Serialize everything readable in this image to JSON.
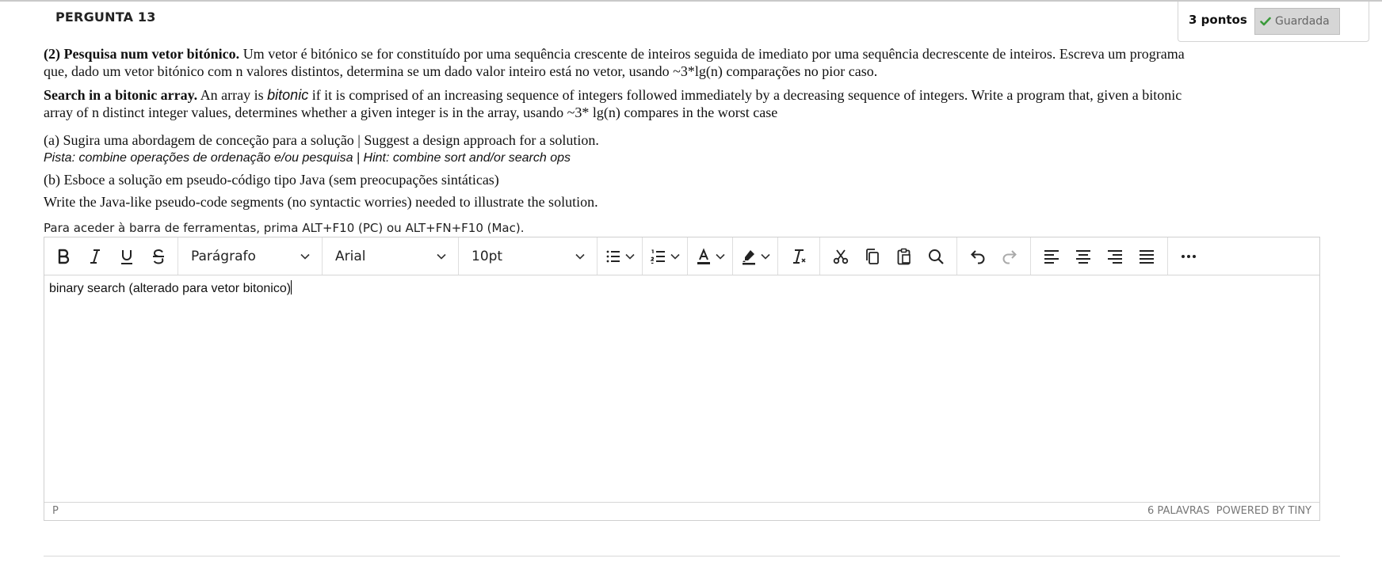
{
  "question": {
    "title": "PERGUNTA 13",
    "points": "3 pontos",
    "status": "Guardada"
  },
  "prompt": {
    "pt_bold": "(2) Pesquisa num vetor bitónico.",
    "pt_text_1": " Um vetor é bitónico se for constituído por uma sequência crescente de inteiros seguida de imediato por uma sequência decrescente de inteiros. Escreva um programa",
    "pt_text_2": "que, dado um vetor bitónico com n valores distintos, determina se um dado valor inteiro está no vetor, usando ~3*lg(n) comparações no pior caso.",
    "en_bold": "Search in a bitonic array.",
    "en_pre": " An array is ",
    "en_italic": "bitonic",
    "en_post": " if it is comprised of an increasing sequence of integers followed immediately by a decreasing sequence of integers. Write a program that, given a bitonic",
    "en_text_2": "array of n distinct integer values, determines whether a given integer is in the array, usando ~3* lg(n) compares in the worst case",
    "part_a": "(a) Sugira uma abordagem de conceção para a solução | Suggest a design approach for a solution.",
    "hint": "Pista: combine operações de ordenação e/ou pesquisa | Hint: combine sort and/or search ops",
    "part_b": "(b) Esboce a solução em pseudo-código tipo Java (sem preocupações sintáticas)",
    "part_b_en": "Write the Java-like pseudo-code segments (no syntactic worries) needed to illustrate the solution."
  },
  "editor": {
    "toolbar_hint": "Para aceder à barra de ferramentas, prima ALT+F10 (PC) ou ALT+FN+F10 (Mac).",
    "block_format": "Parágrafo",
    "font_family": "Arial",
    "font_size": "10pt",
    "content": "binary search (alterado para vetor bitonico)",
    "status_path": "P",
    "word_count": "6 PALAVRAS",
    "powered_by": "POWERED BY TINY"
  },
  "colors": {
    "check": "#3a9a3a",
    "badge_bg": "#d6d6d6"
  },
  "icons": [
    "bold-icon",
    "italic-icon",
    "underline-icon",
    "strikethrough-icon",
    "bullet-list-icon",
    "numbered-list-icon",
    "text-color-icon",
    "highlight-icon",
    "clear-format-icon",
    "cut-icon",
    "copy-icon",
    "paste-icon",
    "search-icon",
    "undo-icon",
    "redo-icon",
    "align-left-icon",
    "align-center-icon",
    "align-right-icon",
    "align-justify-icon",
    "more-icon"
  ]
}
